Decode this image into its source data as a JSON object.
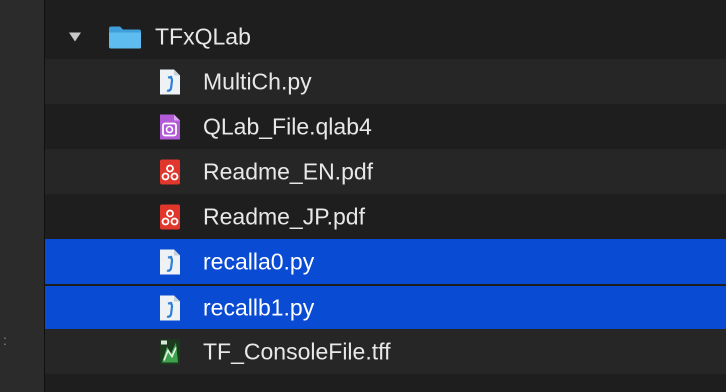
{
  "colors": {
    "background": "#1e1e1e",
    "alternate_row": "#262626",
    "selection": "#0a4bd4",
    "folder": "#5ab6ec",
    "pdf": "#e0362c",
    "qlab": "#b35bd6",
    "python": "#e9eef2"
  },
  "folder": {
    "name": "TFxQLab",
    "icon": "folder-icon",
    "expanded": true
  },
  "files": [
    {
      "name": "MultiCh.py",
      "icon": "python-file-icon",
      "selected": false
    },
    {
      "name": "QLab_File.qlab4",
      "icon": "qlab-file-icon",
      "selected": false
    },
    {
      "name": "Readme_EN.pdf",
      "icon": "pdf-file-icon",
      "selected": false
    },
    {
      "name": "Readme_JP.pdf",
      "icon": "pdf-file-icon",
      "selected": false
    },
    {
      "name": "recalla0.py",
      "icon": "python-file-icon",
      "selected": true
    },
    {
      "name": "recallb1.py",
      "icon": "python-file-icon",
      "selected": true
    },
    {
      "name": "TF_ConsoleFile.tff",
      "icon": "tf-console-file-icon",
      "selected": false
    }
  ]
}
